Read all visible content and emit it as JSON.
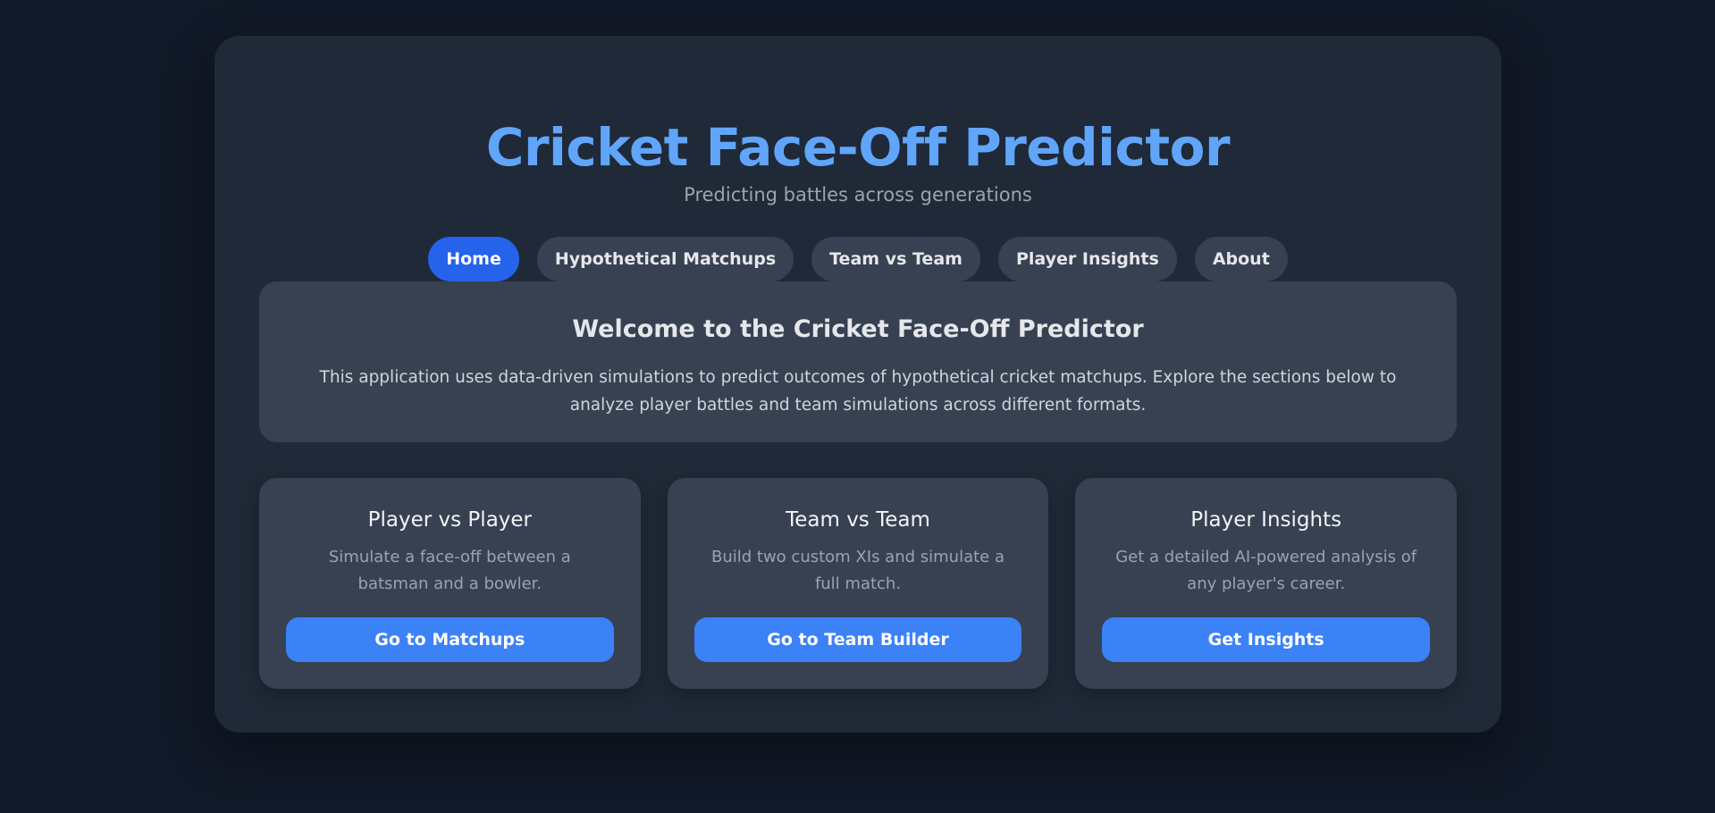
{
  "header": {
    "title": "Cricket Face-Off Predictor",
    "subtitle": "Predicting battles across generations"
  },
  "nav": {
    "items": [
      {
        "label": "Home",
        "active": true
      },
      {
        "label": "Hypothetical Matchups",
        "active": false
      },
      {
        "label": "Team vs Team",
        "active": false
      },
      {
        "label": "Player Insights",
        "active": false
      },
      {
        "label": "About",
        "active": false
      }
    ]
  },
  "welcome": {
    "title": "Welcome to the Cricket Face-Off Predictor",
    "text": "This application uses data-driven simulations to predict outcomes of hypothetical cricket matchups. Explore the sections below to analyze player battles and team simulations across different formats."
  },
  "cards": [
    {
      "title": "Player vs Player",
      "description": "Simulate a face-off between a batsman and a bowler.",
      "button": "Go to Matchups"
    },
    {
      "title": "Team vs Team",
      "description": "Build two custom XIs and simulate a full match.",
      "button": "Go to Team Builder"
    },
    {
      "title": "Player Insights",
      "description": "Get a detailed AI-powered analysis of any player's career.",
      "button": "Get Insights"
    }
  ],
  "colors": {
    "page_background": "#111827",
    "panel_background": "#1f2937",
    "card_background": "#374151",
    "title_accent": "#60a5fa",
    "active_nav": "#2563eb",
    "button": "#3b82f6"
  }
}
